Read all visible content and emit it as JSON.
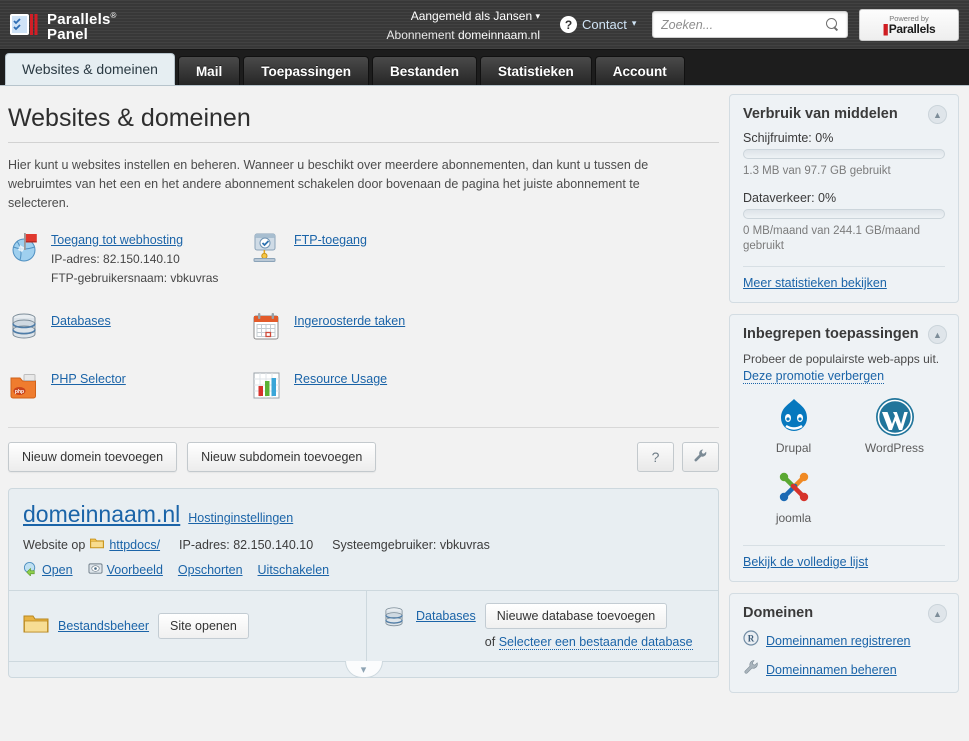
{
  "header": {
    "brand_line1": "Parallels",
    "brand_reg": "®",
    "brand_line2": "Panel",
    "logged_in_label": "Aangemeld als",
    "logged_in_user": "Jansen",
    "subscription_label": "Abonnement",
    "subscription_value": "domeinnaam.nl",
    "contact_label": "Contact",
    "search_placeholder": "Zoeken...",
    "powered_top": "Powered by",
    "powered_bottom": "Parallels"
  },
  "tabs": [
    {
      "label": "Websites & domeinen",
      "active": true
    },
    {
      "label": "Mail",
      "active": false
    },
    {
      "label": "Toepassingen",
      "active": false
    },
    {
      "label": "Bestanden",
      "active": false
    },
    {
      "label": "Statistieken",
      "active": false
    },
    {
      "label": "Account",
      "active": false
    }
  ],
  "main": {
    "page_title": "Websites & domeinen",
    "intro": "Hier kunt u websites instellen en beheren. Wanneer u beschikt over meerdere abonnementen, dan kunt u tussen de webruimtes van het een en het andere abonnement schakelen door bovenaan de pagina het juiste abonnement te selecteren.",
    "tools": [
      {
        "icon": "globe-flag-icon",
        "label": "Toegang tot webhosting",
        "sub1": "IP-adres: 82.150.140.10",
        "sub2": "FTP-gebruikersnaam: vbkuvras"
      },
      {
        "icon": "ftp-folder-icon",
        "label": "FTP-toegang",
        "sub1": "",
        "sub2": ""
      },
      {
        "icon": "database-icon",
        "label": "Databases",
        "sub1": "",
        "sub2": ""
      },
      {
        "icon": "calendar-icon",
        "label": "Ingeroosterde taken",
        "sub1": "",
        "sub2": ""
      },
      {
        "icon": "php-folder-icon",
        "label": "PHP Selector",
        "sub1": "",
        "sub2": ""
      },
      {
        "icon": "bar-chart-icon",
        "label": "Resource Usage",
        "sub1": "",
        "sub2": ""
      }
    ],
    "buttons": {
      "add_domain": "Nieuw domein toevoegen",
      "add_subdomain": "Nieuw subdomein toevoegen",
      "help_icon": "question-mark-icon",
      "tools_icon": "wrench-icon"
    },
    "domain_card": {
      "domain": "domeinnaam.nl",
      "hosting_settings": "Hostinginstellingen",
      "website_on_label": "Website op",
      "website_on_value": "httpdocs/",
      "ip_label": "IP-adres: 82.150.140.10",
      "sysuser_label": "Systeemgebruiker: vbkuvras",
      "actions": [
        {
          "icon": "open-icon",
          "label": "Open"
        },
        {
          "icon": "preview-icon",
          "label": "Voorbeeld"
        },
        {
          "icon": "",
          "label": "Opschorten"
        },
        {
          "icon": "",
          "label": "Uitschakelen"
        }
      ],
      "file_manager_link": "Bestandsbeheer",
      "open_site_button": "Site openen",
      "databases_link": "Databases",
      "add_database_button": "Nieuwe database toevoegen",
      "or_label": "of",
      "select_existing_db": "Selecteer een bestaande database",
      "expand_icon": "chevron-down-icon"
    }
  },
  "sidebar": {
    "resources": {
      "title": "Verbruik van middelen",
      "collapse_icon": "chevron-up-icon",
      "disk_label": "Schijfruimte: 0%",
      "disk_percent": 0,
      "disk_note": "1.3 MB van 97.7 GB gebruikt",
      "traffic_label": "Dataverkeer: 0%",
      "traffic_percent": 0,
      "traffic_note": "0 MB/maand van 244.1 GB/maand gebruikt",
      "more_stats_link": "Meer statistieken bekijken"
    },
    "apps": {
      "title": "Inbegrepen toepassingen",
      "collapse_icon": "chevron-up-icon",
      "promo_text": "Probeer de populairste web-apps uit.",
      "hide_promo_link": "Deze promotie verbergen",
      "items": [
        {
          "name": "Drupal",
          "icon": "drupal-icon"
        },
        {
          "name": "WordPress",
          "icon": "wordpress-icon"
        },
        {
          "name": "joomla",
          "icon": "joomla-icon"
        }
      ],
      "full_list_link": "Bekijk de volledige lijst"
    },
    "domains": {
      "title": "Domeinen",
      "collapse_icon": "chevron-up-icon",
      "items": [
        {
          "icon": "registered-r-icon",
          "label": "Domeinnamen registreren"
        },
        {
          "icon": "wrench-icon",
          "label": "Domeinnamen beheren"
        }
      ]
    }
  },
  "colors": {
    "accent_link": "#1b64a8",
    "header_bg": "#3b3b3b",
    "panel_bg": "#eef2f5",
    "card_bg": "#e8eef2",
    "active_tab_bg": "#e6eef2"
  }
}
